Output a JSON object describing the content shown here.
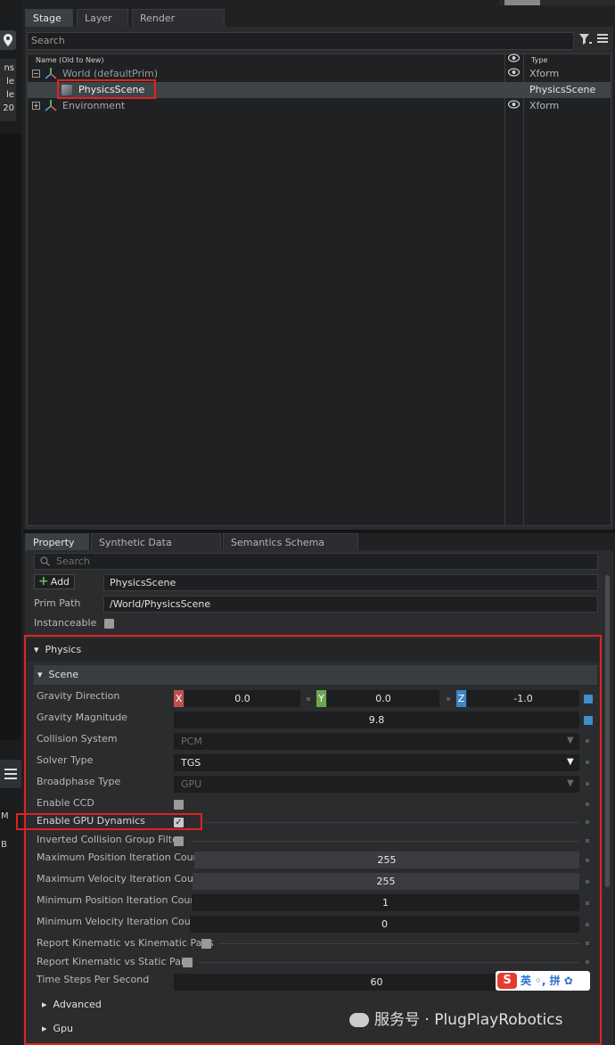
{
  "left_strip": {
    "lines": [
      "ns",
      "le",
      "le",
      "20"
    ],
    "bottom_lines": [
      "M",
      "B"
    ]
  },
  "stage_tabs": [
    {
      "label": "Stage"
    },
    {
      "label": "Layer"
    },
    {
      "label": "Render Settings"
    }
  ],
  "stage": {
    "search_placeholder": "Search",
    "col_name": "Name (Old to New)",
    "col_type": "Type",
    "rows": [
      {
        "name": "World (defaultPrim)",
        "type": "Xform"
      },
      {
        "name": "PhysicsScene",
        "type": "PhysicsScene"
      },
      {
        "name": "Environment",
        "type": "Xform"
      }
    ]
  },
  "property_tabs": [
    {
      "label": "Property"
    },
    {
      "label": "Synthetic Data Recorder"
    },
    {
      "label": "Semantics Schema Editor"
    }
  ],
  "property": {
    "search_placeholder": "Search",
    "add_label": "Add",
    "prim_name": "PhysicsScene",
    "prim_path_label": "Prim Path",
    "prim_path": "/World/PhysicsScene",
    "instanceable_label": "Instanceable"
  },
  "physics": {
    "header": "Physics",
    "scene_header": "Scene",
    "gravity_direction": {
      "label": "Gravity Direction",
      "x": "0.0",
      "y": "0.0",
      "z": "-1.0",
      "axes": [
        "X",
        "Y",
        "Z"
      ]
    },
    "gravity_magnitude": {
      "label": "Gravity Magnitude",
      "value": "9.8"
    },
    "collision_system": {
      "label": "Collision System",
      "value": "PCM"
    },
    "solver_type": {
      "label": "Solver Type",
      "value": "TGS"
    },
    "broadphase_type": {
      "label": "Broadphase Type",
      "value": "GPU"
    },
    "enable_ccd": {
      "label": "Enable CCD"
    },
    "enable_gpu_dynamics": {
      "label": "Enable GPU Dynamics",
      "checked": true
    },
    "inverted_collision": {
      "label": "Inverted Collision Group Filter"
    },
    "max_pos_iter": {
      "label": "Maximum Position Iteration Count",
      "value": "255"
    },
    "max_vel_iter": {
      "label": "Maximum Velocity Iteration Count",
      "value": "255"
    },
    "min_pos_iter": {
      "label": "Minimum Position Iteration Count",
      "value": "1"
    },
    "min_vel_iter": {
      "label": "Minimum Velocity Iteration Count",
      "value": "0"
    },
    "report_kk": {
      "label": "Report Kinematic vs Kinematic Pairs"
    },
    "report_ks": {
      "label": "Report Kinematic vs Static Pairs"
    },
    "time_steps": {
      "label": "Time Steps Per Second",
      "value": "60"
    },
    "advanced": "Advanced",
    "gpu": "Gpu"
  },
  "ime": {
    "logo": "S",
    "text": "英 ◦, 拼 ✿"
  },
  "watermark": "服务号 · PlugPlayRobotics",
  "colors": {
    "accent_blue": "#3f8fc9",
    "highlight_red": "#e0231e",
    "x_axis": "#c0504d",
    "y_axis": "#6aa84f",
    "z_axis": "#3d85c6"
  }
}
